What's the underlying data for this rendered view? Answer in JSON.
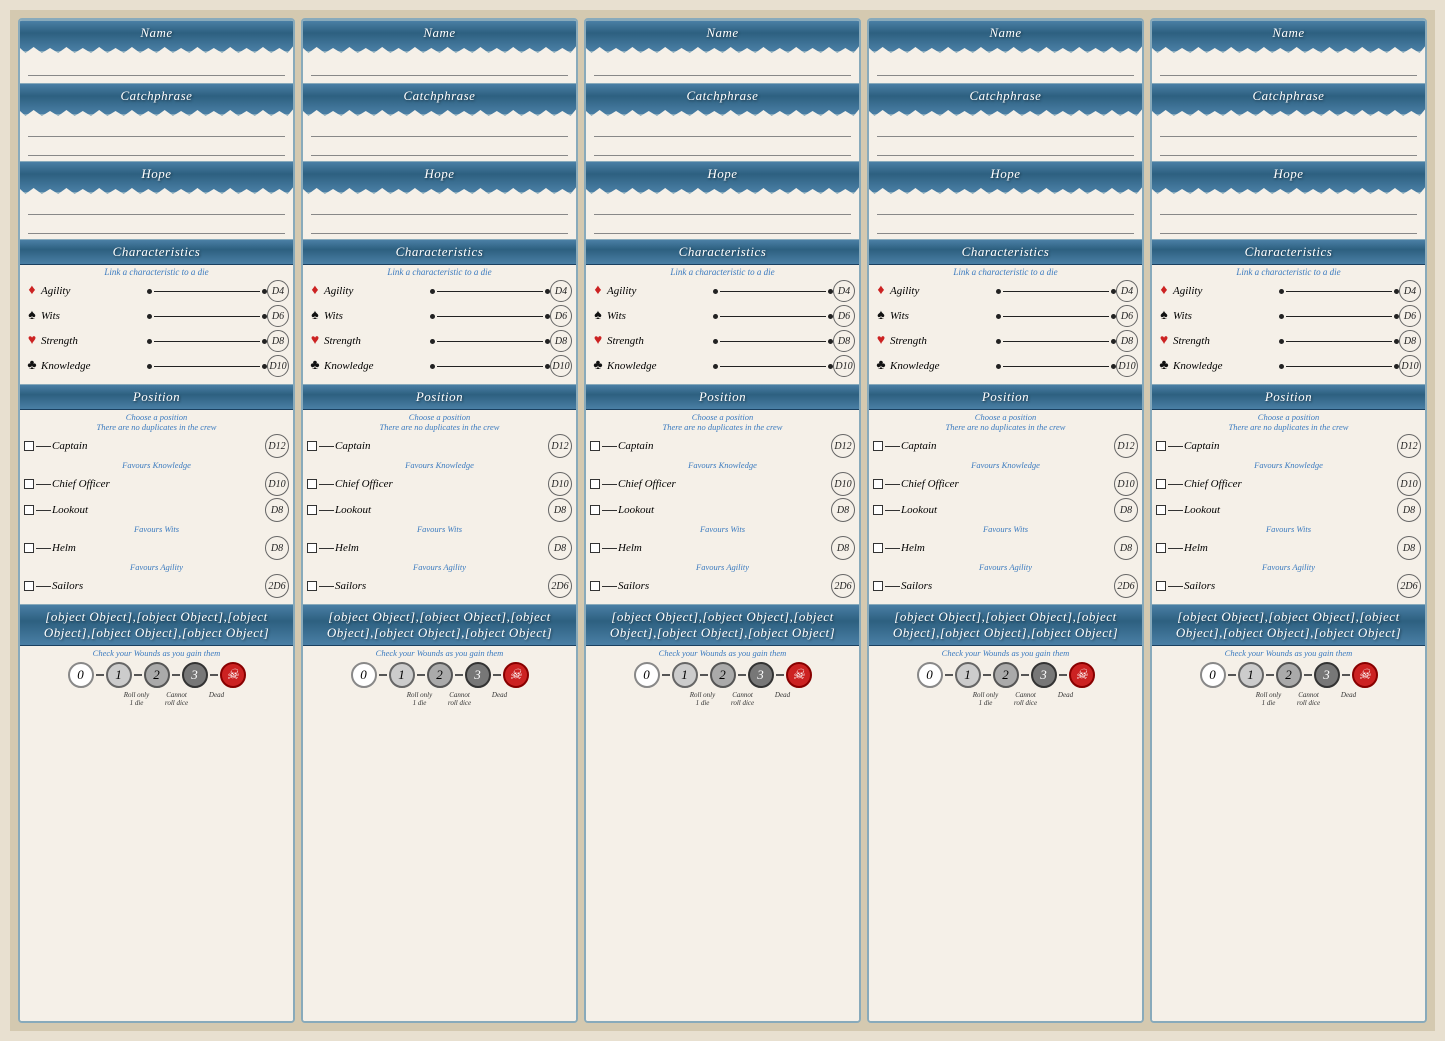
{
  "cards": [
    {
      "id": 1
    },
    {
      "id": 2
    },
    {
      "id": 3
    },
    {
      "id": 4
    },
    {
      "id": 5
    }
  ],
  "labels": {
    "name": "Name",
    "catchphrase": "Catchphrase",
    "hope": "Hope",
    "characteristics": "Characteristics",
    "char_subtitle": "Link a characteristic to a die",
    "position": "Position",
    "pos_subtitle1": "Choose a position",
    "pos_subtitle2": "There are no duplicates in the crew",
    "wounds": [
      {
        "label": "0",
        "class": "w0"
      },
      {
        "label": "1",
        "class": "w1"
      },
      {
        "label": "2",
        "class": "w2"
      },
      {
        "label": "3",
        "class": "w3"
      },
      {
        "label": "☠",
        "class": "dead"
      }
    ],
    "wounds_subtitle": "Check your Wounds as you gain them",
    "chars": [
      {
        "name": "Agility",
        "icon": "♦",
        "type": "diamond",
        "die": "D4"
      },
      {
        "name": "Wits",
        "icon": "♠",
        "type": "spade",
        "die": "D6"
      },
      {
        "name": "Strength",
        "icon": "♥",
        "type": "heart",
        "die": "D8"
      },
      {
        "name": "Knowledge",
        "icon": "♣",
        "type": "club",
        "die": "D10"
      }
    ],
    "positions": [
      {
        "name": "Captain",
        "die": "D12",
        "favour": "Favours Knowledge"
      },
      {
        "name": "Chief Officer",
        "die": "D10",
        "favour": ""
      },
      {
        "name": "Lookout",
        "die": "D8",
        "favour": "Favours Wits"
      },
      {
        "name": "Helm",
        "die": "D8",
        "favour": "Favours Agility"
      },
      {
        "name": "Sailors",
        "die": "2D6",
        "favour": ""
      }
    ],
    "wound_labels": [
      {
        "text": ""
      },
      {
        "text": "Roll only\n1 die"
      },
      {
        "text": "Cannot\nroll dice"
      },
      {
        "text": "Dead"
      }
    ]
  }
}
